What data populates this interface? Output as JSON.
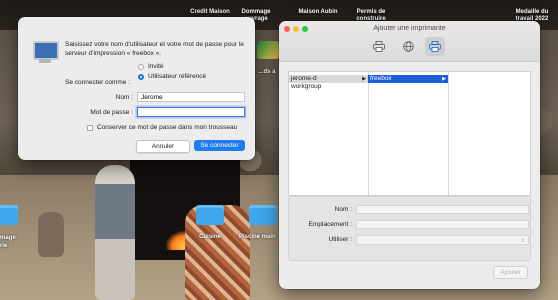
{
  "desktop": {
    "labels": [
      {
        "text": "Credit Maison"
      },
      {
        "text": "Dommage\nouvrage"
      },
      {
        "text": "Maison Aubin"
      },
      {
        "text": "Permis de\nconstruire"
      },
      {
        "text": "Medaille du\ntravail 2022"
      },
      {
        "text": "...ds a"
      },
      {
        "text": "mage"
      },
      {
        "text": "rie"
      },
      {
        "text": "Cuisine"
      },
      {
        "text": "Piscine main"
      }
    ]
  },
  "auth_dialog": {
    "message": "Saisissez votre nom d’utilisateur et votre mot de passe pour le serveur d’impression « freebox ».",
    "connect_as_label": "Se connecter comme :",
    "option_guest": "Invité",
    "option_registered": "Utilisateur référencé",
    "selected_option": "Utilisateur référencé",
    "name_label": "Nom :",
    "name_value": "Jerome",
    "password_label": "Mot de passe :",
    "password_value": "",
    "keychain_label": "Conserver ce mot de passe dans mon trousseau",
    "keychain_checked": false,
    "cancel_label": "Annuler",
    "connect_label": "Se connecter",
    "accent_color": "#1f7cf0"
  },
  "printer_window": {
    "title": "Ajouter une imprimante",
    "toolbar": [
      {
        "icon": "default-printer-icon",
        "active": false
      },
      {
        "icon": "ip-globe-icon",
        "active": false
      },
      {
        "icon": "windows-printer-icon",
        "active": true
      }
    ],
    "columns": [
      {
        "items": [
          {
            "label": "jerome-d",
            "selected": "inactive",
            "has_children": true
          },
          {
            "label": "workgroup",
            "selected": "none",
            "has_children": false
          }
        ]
      },
      {
        "items": [
          {
            "label": "freebox",
            "selected": "active",
            "has_children": true
          }
        ]
      },
      {
        "items": []
      }
    ],
    "name_label": "Nom :",
    "location_label": "Emplacement :",
    "use_label": "Utiliser :",
    "add_button": "Ajouter"
  }
}
